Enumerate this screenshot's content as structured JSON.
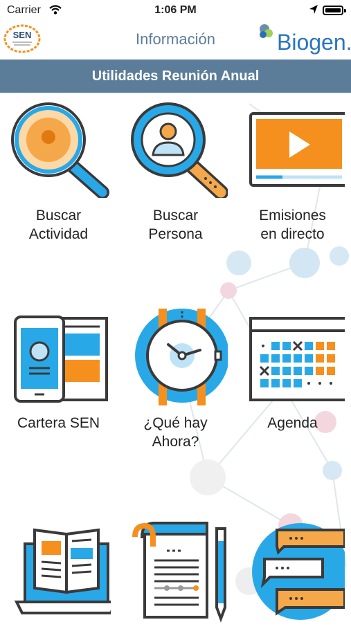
{
  "status": {
    "carrier": "Carrier",
    "time": "1:06 PM"
  },
  "nav": {
    "title": "Información",
    "sen_logo_text": "SEN",
    "brand": "Biogen."
  },
  "banner": {
    "title": "Utilidades Reunión Anual"
  },
  "tiles": [
    {
      "label": "Buscar\nActividad",
      "icon": "search-activity-icon"
    },
    {
      "label": "Buscar\nPersona",
      "icon": "search-person-icon"
    },
    {
      "label": "Emisiones\nen directo",
      "icon": "live-video-icon"
    },
    {
      "label": "Cartera SEN",
      "icon": "phone-portfolio-icon"
    },
    {
      "label": "¿Qué hay\nAhora?",
      "icon": "watch-icon"
    },
    {
      "label": "Agenda",
      "icon": "calendar-icon"
    },
    {
      "label": "",
      "icon": "laptop-book-icon"
    },
    {
      "label": "",
      "icon": "document-pen-icon"
    },
    {
      "label": "",
      "icon": "chat-bubbles-icon"
    }
  ],
  "colors": {
    "accent": "#5b7d9a",
    "orange": "#f5901e",
    "blue": "#29a8e8",
    "dark": "#3a3a3a"
  }
}
